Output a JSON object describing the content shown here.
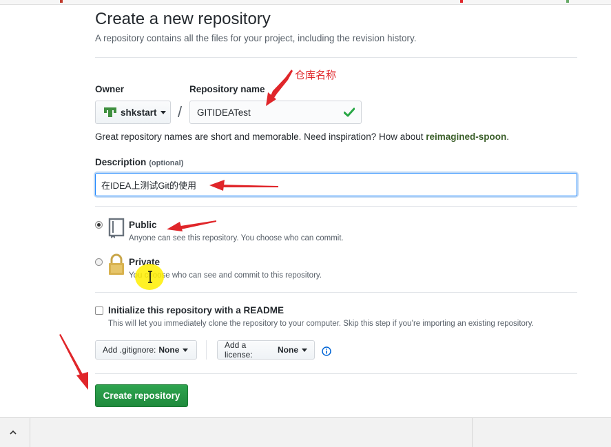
{
  "page": {
    "title": "Create a new repository",
    "subtitle": "A repository contains all the files for your project, including the revision history."
  },
  "owner": {
    "label": "Owner",
    "value": "shkstart"
  },
  "repo_name": {
    "label": "Repository name",
    "value": "GITIDEATest",
    "slash": "/"
  },
  "hint": {
    "text": "Great repository names are short and memorable. Need inspiration? How about ",
    "suggestion": "reimagined-spoon",
    "end": "."
  },
  "description": {
    "label": "Description",
    "optional": "(optional)",
    "value": "在IDEA上测试Git的使用"
  },
  "visibility": {
    "public": {
      "title": "Public",
      "desc": "Anyone can see this repository. You choose who can commit.",
      "checked": true
    },
    "private": {
      "title": "Private",
      "desc": "You choose who can see and commit to this repository.",
      "checked": false
    }
  },
  "readme": {
    "title": "Initialize this repository with a README",
    "desc": "This will let you immediately clone the repository to your computer. Skip this step if you’re importing an existing repository."
  },
  "gitignore": {
    "label": "Add .gitignore:",
    "value": "None"
  },
  "license": {
    "label": "Add a license:",
    "value": "None"
  },
  "create_button": "Create repository",
  "annotation": {
    "text": "仓库名称",
    "color": "#e0262a"
  },
  "icons": {
    "owner_avatar": "owner-avatar-icon",
    "check": "check-icon",
    "public": "repo-book-icon",
    "private": "lock-icon",
    "info": "info-icon",
    "cursor": "text-cursor-icon",
    "taskbar_up": "chevron-up-icon"
  },
  "colors": {
    "create_button": "#2ea44f",
    "focus_border": "#2188ff",
    "check": "#28a745",
    "suggestion": "#3b5f2a"
  }
}
